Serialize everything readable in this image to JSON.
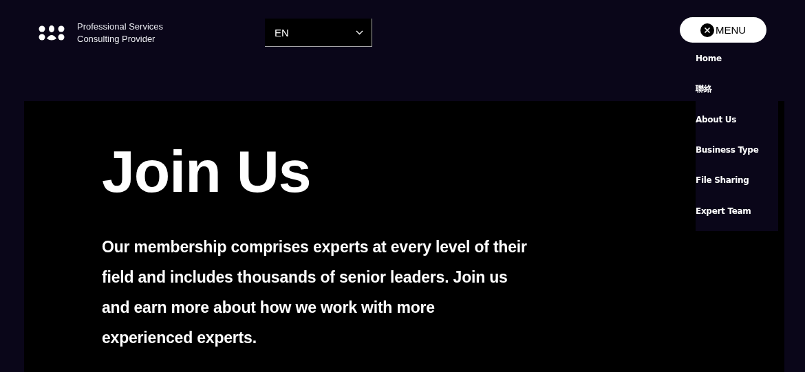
{
  "brand": {
    "line_1": "Professional Services",
    "line_2": "Consulting Provider"
  },
  "language": {
    "value": "EN"
  },
  "menu_button": {
    "label": "MENU",
    "expanded": true
  },
  "menu": {
    "items": [
      {
        "label": "Home"
      },
      {
        "label": "聯絡"
      },
      {
        "label": "About Us"
      },
      {
        "label": "Business Type"
      },
      {
        "label": "File Sharing"
      },
      {
        "label": "Expert Team"
      }
    ]
  },
  "hero": {
    "title": "Join Us",
    "text": "Our membership comprises experts at every level of their field and includes thousands of senior leaders. Join us and earn more about how we work with more experienced experts."
  }
}
